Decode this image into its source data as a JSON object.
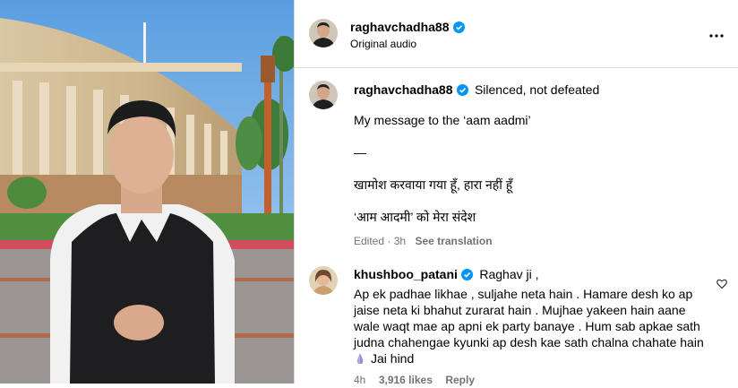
{
  "header": {
    "username": "raghavchadha88",
    "audio": "Original audio",
    "more_icon": "more-horizontal-icon"
  },
  "caption": {
    "username": "raghavchadha88",
    "title": "Silenced, not defeated",
    "line1": "My message to the ‘aam aadmi’",
    "dash": "—",
    "hindi1": "खामोश करवाया गया हूँ, हारा नहीं हूँ",
    "hindi2": "‘आम आदमी’ को मेरा संदेश",
    "meta": "Edited · 3h",
    "see_translation": "See translation"
  },
  "comment": {
    "username": "khushboo_patani",
    "first": "Raghav ji ,",
    "line1": "Ap ek padhae likhae , suljahe neta hain . Hamare desh ko ap",
    "line2": "jaise neta ki bhahut zurarat hain . Mujhae yakeen hain aane",
    "line3": "wale waqt mae ap apni ek party banaye . Hum sab apkae sath",
    "line4": "judna chahengae kyunki ap desh kae sath chalna chahate hain",
    "jai": "Jai hind",
    "time": "4h",
    "likes": "3,916 likes",
    "reply": "Reply",
    "heart_icon": "heart-icon"
  },
  "colors": {
    "verified": "#0095f6",
    "muted": "#737373",
    "divider": "#dbdbdb"
  }
}
